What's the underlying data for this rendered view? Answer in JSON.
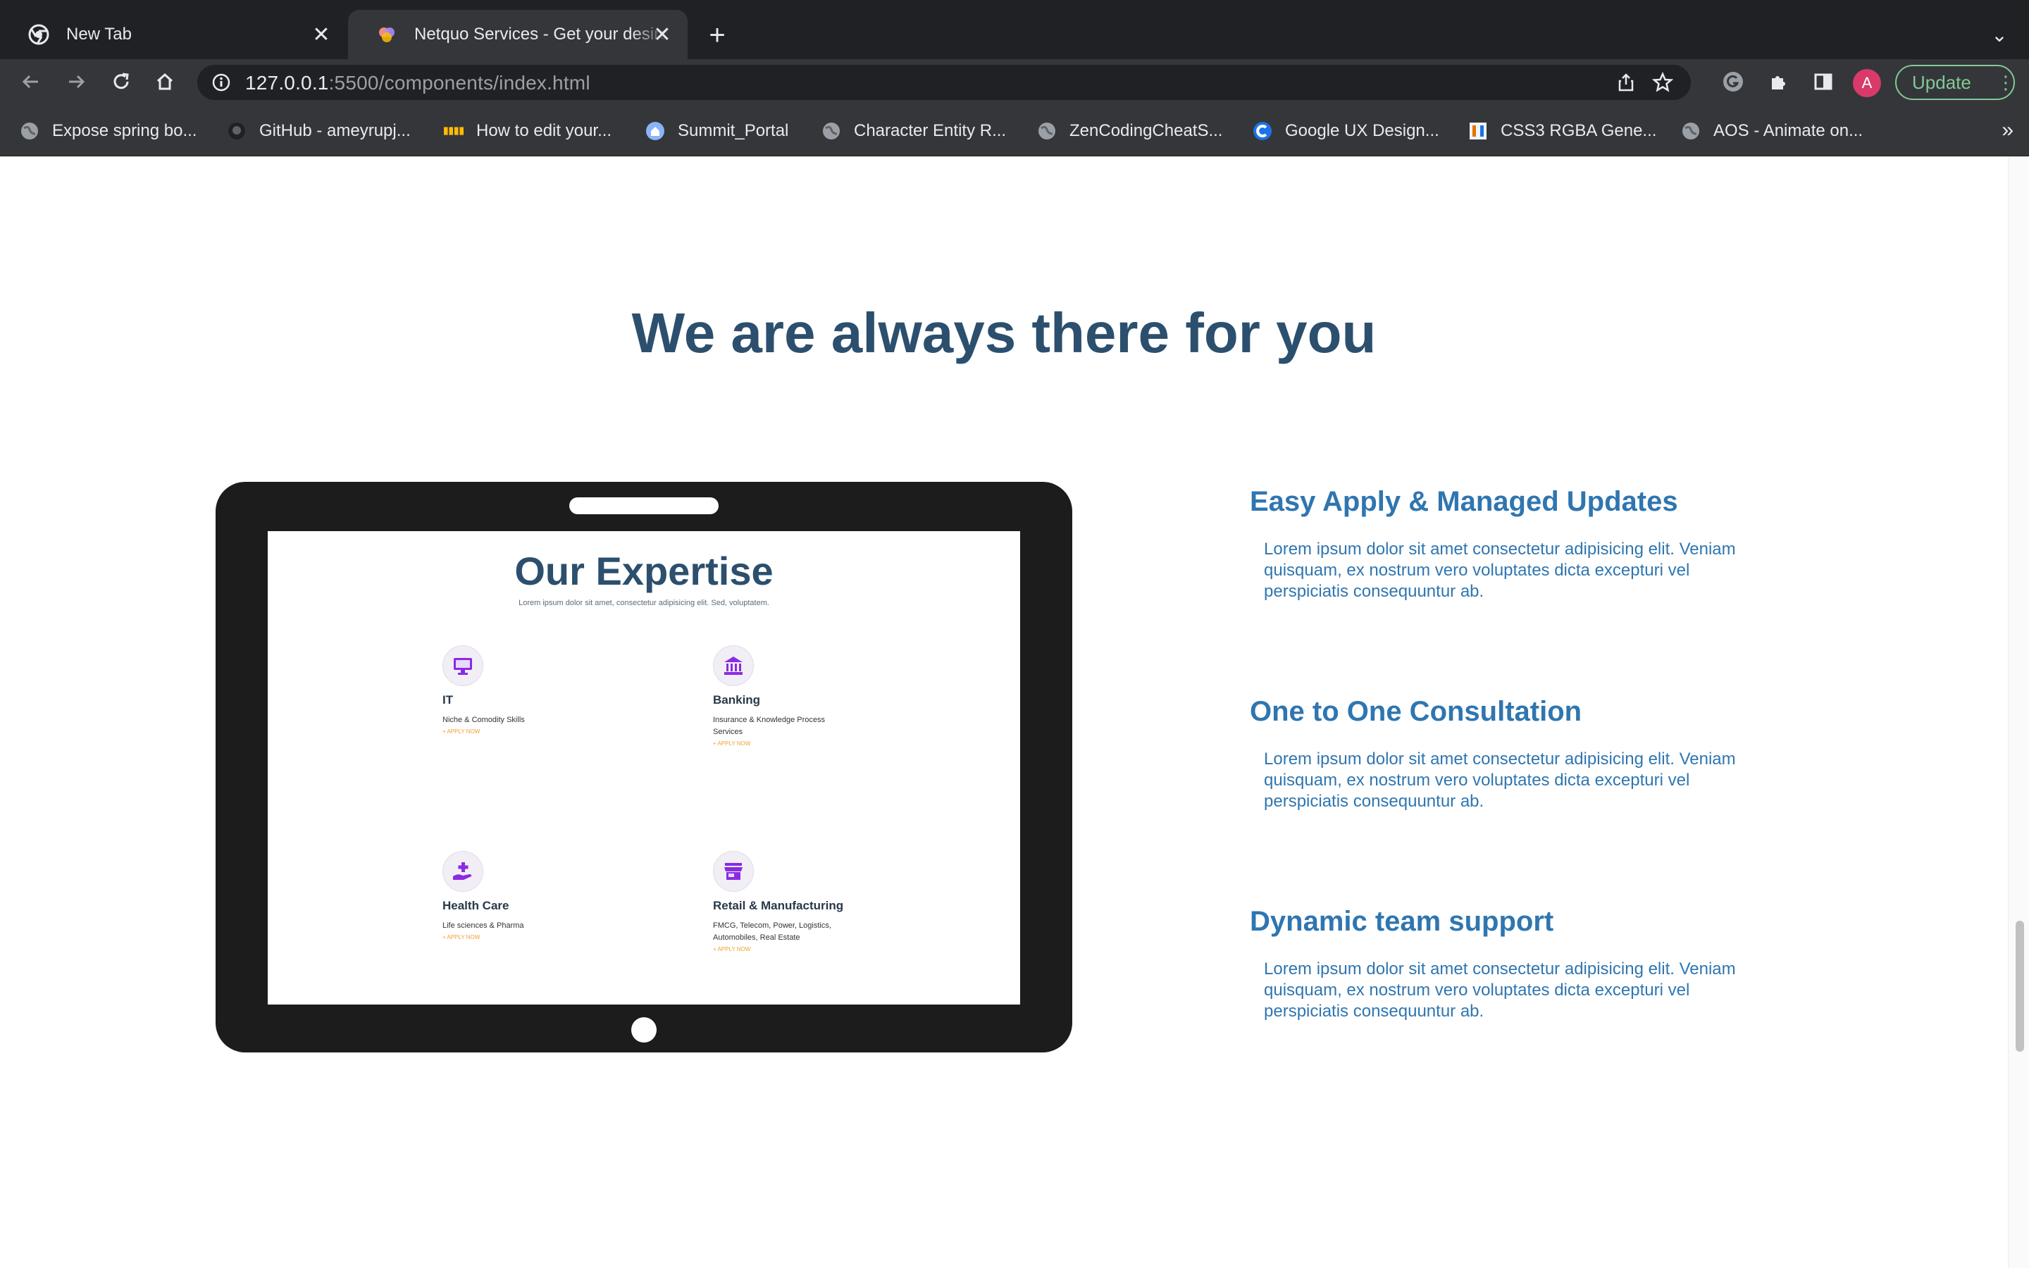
{
  "browser": {
    "tabs": [
      {
        "title": "New Tab",
        "active": false
      },
      {
        "title": "Netquo Services - Get your desired job",
        "active": true
      }
    ],
    "url_host": "127.0.0.1",
    "url_path": ":5500/components/index.html",
    "avatar_letter": "A",
    "update_label": "Update",
    "bookmarks": [
      {
        "label": "Expose spring bo...",
        "icon": "globe-icon"
      },
      {
        "label": "GitHub - ameyrupj...",
        "icon": "github-icon"
      },
      {
        "label": "How to edit your...",
        "icon": "site-icon"
      },
      {
        "label": "Summit_Portal",
        "icon": "home-icon"
      },
      {
        "label": "Character Entity R...",
        "icon": "globe-icon"
      },
      {
        "label": "ZenCodingCheatS...",
        "icon": "globe-icon"
      },
      {
        "label": "Google UX Design...",
        "icon": "coursera-icon"
      },
      {
        "label": "CSS3 RGBA Gene...",
        "icon": "css3-icon"
      },
      {
        "label": "AOS - Animate on...",
        "icon": "globe-icon"
      }
    ]
  },
  "page": {
    "heading": "We are always there for you",
    "tablet_screen": {
      "title": "Our Expertise",
      "subtitle": "Lorem ipsum dolor sit amet, consectetur adipisicing elit. Sed, voluptatem.",
      "cards": [
        {
          "title": "IT",
          "text": "Niche & Comodity Skills",
          "link": "+ APPLY NOW",
          "icon": "monitor-icon"
        },
        {
          "title": "Banking",
          "text": "Insurance & Knowledge Process Services",
          "link": "+ APPLY NOW",
          "icon": "bank-icon"
        },
        {
          "title": "Health Care",
          "text": "Life sciences & Pharma",
          "link": "+ APPLY NOW",
          "icon": "medical-hand-icon"
        },
        {
          "title": "Retail & Manufacturing",
          "text": "FMCG, Telecom, Power, Logistics, Automobiles, Real Estate",
          "link": "+ APPLY NOW",
          "icon": "store-icon"
        }
      ]
    },
    "features": [
      {
        "title": "Easy Apply & Managed Updates",
        "text": "Lorem ipsum dolor sit amet consectetur adipisicing elit. Veniam quisquam, ex nostrum vero voluptates dicta excepturi vel perspiciatis consequuntur ab."
      },
      {
        "title": "One to One Consultation",
        "text": "Lorem ipsum dolor sit amet consectetur adipisicing elit. Veniam quisquam, ex nostrum vero voluptates dicta excepturi vel perspiciatis consequuntur ab."
      },
      {
        "title": "Dynamic team support",
        "text": "Lorem ipsum dolor sit amet consectetur adipisicing elit. Veniam quisquam, ex nostrum vero voluptates dicta excepturi vel perspiciatis consequuntur ab."
      }
    ]
  },
  "colors": {
    "heading": "#2c4f6e",
    "feature_blue": "#2f76b0",
    "apply_link": "#f0a030",
    "icon_purple": "#8a2be2"
  }
}
